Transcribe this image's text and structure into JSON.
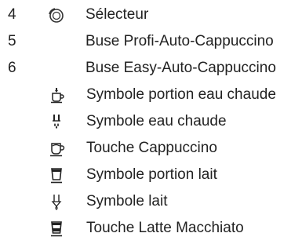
{
  "legend": {
    "items": [
      {
        "number": "4",
        "icon": "selector-dial-icon",
        "label": "Sélecteur"
      },
      {
        "number": "5",
        "icon": "",
        "label": "Buse Profi-Auto-Cappuccino"
      },
      {
        "number": "6",
        "icon": "",
        "label": "Buse Easy-Auto-Cappuccino"
      }
    ],
    "sub_items": [
      {
        "icon": "hot-water-portion-icon",
        "label": "Symbole portion eau chaude"
      },
      {
        "icon": "hot-water-icon",
        "label": "Symbole eau chaude"
      },
      {
        "icon": "cappuccino-cup-icon",
        "label": "Touche Cappuccino"
      },
      {
        "icon": "milk-portion-glass-icon",
        "label": "Symbole portion lait"
      },
      {
        "icon": "milk-drop-icon",
        "label": "Symbole lait"
      },
      {
        "icon": "latte-macchiato-glass-icon",
        "label": "Touche Latte Macchiato"
      }
    ]
  }
}
